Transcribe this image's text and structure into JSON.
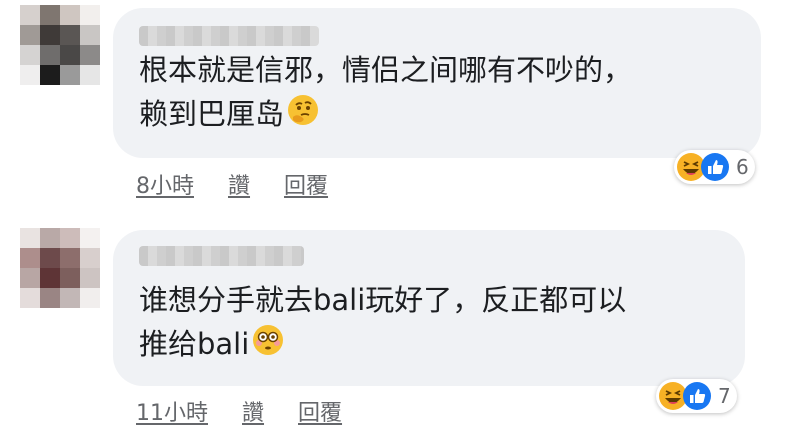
{
  "comments": [
    {
      "text_line1": "根本就是信邪，情侣之间哪有不吵的，",
      "text_line2": "赖到巴厘岛",
      "emoji": "thinking-face-emoji",
      "time": "8小時",
      "like_label": "讚",
      "reply_label": "回覆",
      "reaction_count": "6",
      "reactions": [
        "haha-reaction",
        "like-reaction"
      ]
    },
    {
      "text_line1": "谁想分手就去bali玩好了，反正都可以",
      "text_line2": "推给bali",
      "emoji": "flushed-face-emoji",
      "time": "11小時",
      "like_label": "讚",
      "reply_label": "回覆",
      "reaction_count": "7",
      "reactions": [
        "haha-reaction",
        "like-reaction"
      ]
    }
  ],
  "colors": {
    "bubble": "#f0f2f5",
    "meta_text": "#65676b",
    "like_blue": "#1877f2",
    "haha_yellow": "#f7b125"
  }
}
